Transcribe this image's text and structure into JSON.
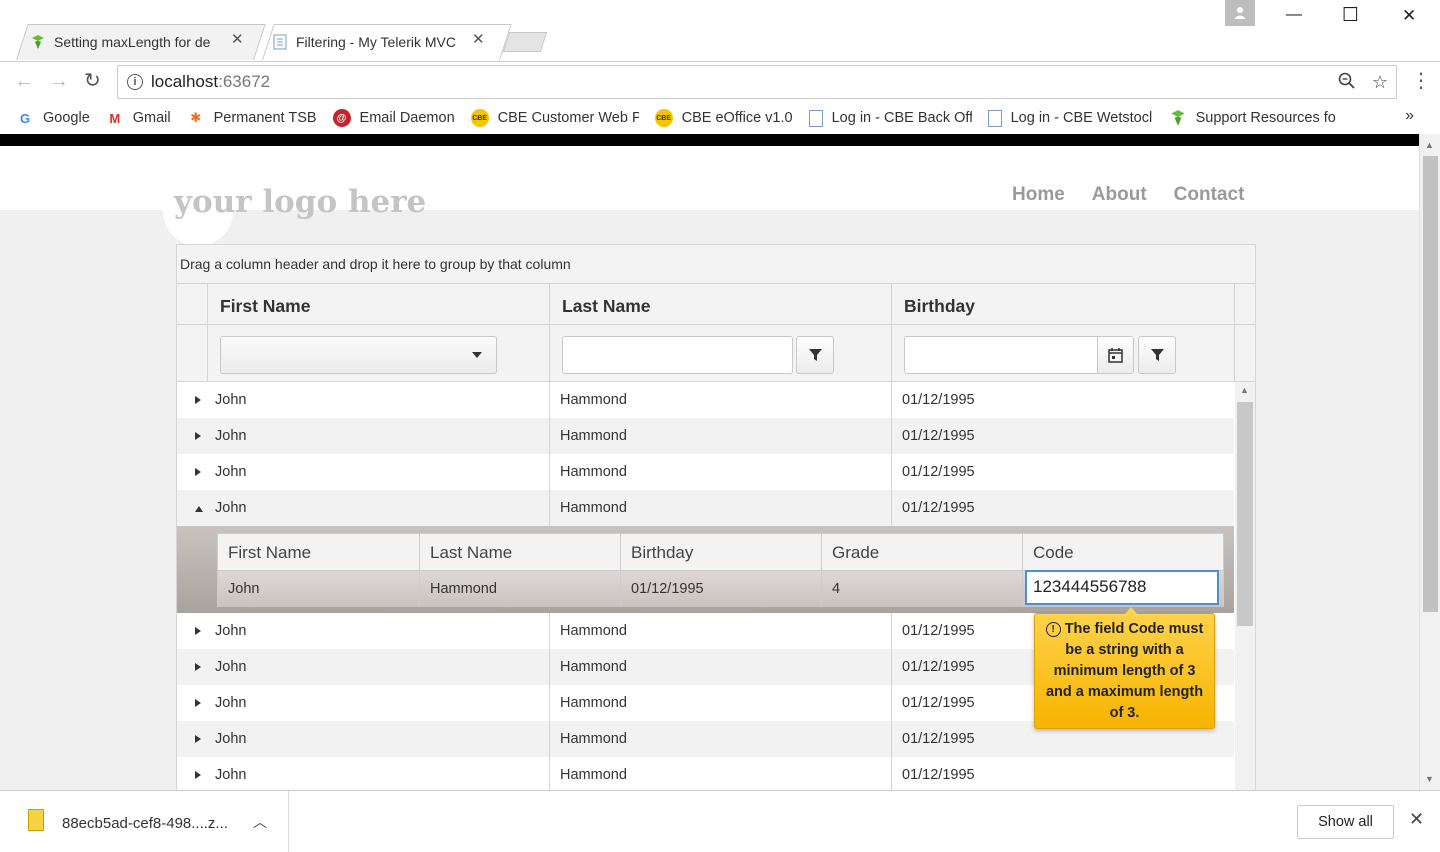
{
  "browser": {
    "tabs": [
      {
        "title": "Setting maxLength for de",
        "active": false
      },
      {
        "title": "Filtering - My Telerik MVC",
        "active": true
      }
    ],
    "url_host": "localhost",
    "url_port": ":63672",
    "bookmarks": [
      {
        "label": "Google",
        "icon": "google-icon"
      },
      {
        "label": "Gmail",
        "icon": "gmail-icon"
      },
      {
        "label": "Permanent TSB",
        "icon": "ptsb-icon"
      },
      {
        "label": "Email Daemon",
        "icon": "daemon-icon"
      },
      {
        "label": "CBE Customer Web P",
        "icon": "cbe-icon"
      },
      {
        "label": "CBE eOffice v1.0",
        "icon": "cbe-icon"
      },
      {
        "label": "Log in - CBE Back Off",
        "icon": "page-icon"
      },
      {
        "label": "Log in - CBE Wetstocl",
        "icon": "page-icon"
      },
      {
        "label": "Support Resources fo",
        "icon": "support-icon"
      }
    ],
    "bookmarks_more": "»"
  },
  "site": {
    "logo": "your logo here",
    "nav": [
      "Home",
      "About",
      "Contact"
    ]
  },
  "grid": {
    "group_hint": "Drag a column header and drop it here to group by that column",
    "columns": [
      "First Name",
      "Last Name",
      "Birthday"
    ],
    "rows": [
      {
        "first": "John",
        "last": "Hammond",
        "birthday": "01/12/1995"
      },
      {
        "first": "John",
        "last": "Hammond",
        "birthday": "01/12/1995"
      },
      {
        "first": "John",
        "last": "Hammond",
        "birthday": "01/12/1995"
      },
      {
        "first": "John",
        "last": "Hammond",
        "birthday": "01/12/1995"
      },
      {
        "first": "John",
        "last": "Hammond",
        "birthday": "01/12/1995"
      },
      {
        "first": "John",
        "last": "Hammond",
        "birthday": "01/12/1995"
      },
      {
        "first": "John",
        "last": "Hammond",
        "birthday": "01/12/1995"
      },
      {
        "first": "John",
        "last": "Hammond",
        "birthday": "01/12/1995"
      },
      {
        "first": "John",
        "last": "Hammond",
        "birthday": "01/12/1995"
      }
    ],
    "detail": {
      "columns": [
        "First Name",
        "Last Name",
        "Birthday",
        "Grade",
        "Code"
      ],
      "row": {
        "first": "John",
        "last": "Hammond",
        "birthday": "01/12/1995",
        "grade": "4",
        "code": "123444556788"
      }
    },
    "validation_message": "The field Code must be a string with a minimum length of 3 and a maximum length of 3."
  },
  "downloads": {
    "file": "88ecb5ad-cef8-498....z...",
    "show_all": "Show all"
  }
}
